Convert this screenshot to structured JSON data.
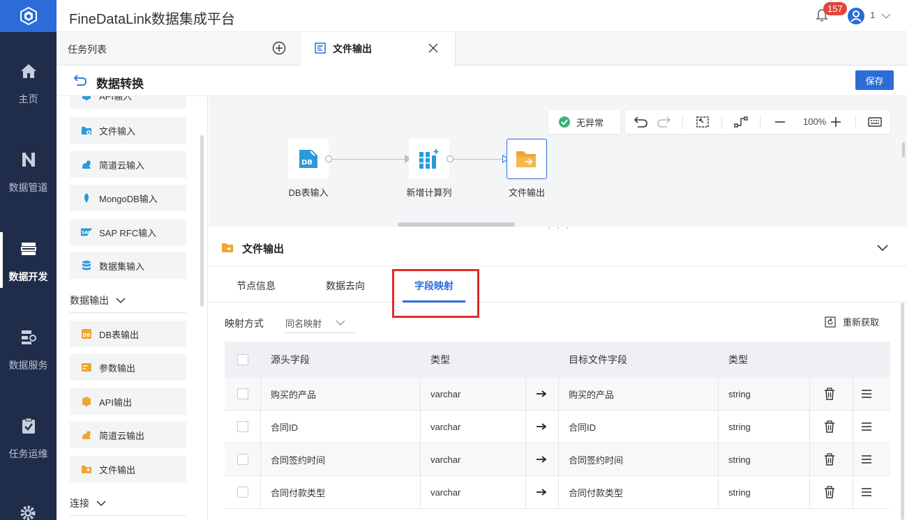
{
  "app": {
    "title": "FineDataLink数据集成平台",
    "notification_count": "157",
    "user_name": "1"
  },
  "nav": {
    "items": [
      {
        "label": "主页",
        "icon": "home-icon"
      },
      {
        "label": "数据管道",
        "icon": "pipeline-icon"
      },
      {
        "label": "数据开发",
        "icon": "data-dev-icon",
        "active": true
      },
      {
        "label": "数据服务",
        "icon": "data-service-icon"
      },
      {
        "label": "任务运维",
        "icon": "task-ops-icon"
      }
    ]
  },
  "tabs": {
    "list_label": "任务列表",
    "active_label": "文件输出"
  },
  "subheader": {
    "title": "数据转换",
    "save_label": "保存"
  },
  "components": {
    "items_top": [
      "API输入",
      "文件输入",
      "简道云输入",
      "MongoDB输入",
      "SAP RFC输入",
      "数据集输入"
    ],
    "output_section": "数据输出",
    "items_output": [
      "DB表输出",
      "参数输出",
      "API输出",
      "简道云输出",
      "文件输出"
    ],
    "connect_section": "连接"
  },
  "canvas": {
    "status": "无异常",
    "zoom": "100%",
    "nodes": [
      {
        "label": "DB表输入",
        "icon": "db-input-icon"
      },
      {
        "label": "新增计算列",
        "icon": "calc-column-icon"
      },
      {
        "label": "文件输出",
        "icon": "file-output-icon"
      }
    ]
  },
  "config": {
    "title": "文件输出",
    "tabs": [
      "节点信息",
      "数据去向",
      "字段映射"
    ],
    "active_tab": "字段映射",
    "mapping_label": "映射方式",
    "mapping_value": "同名映射",
    "refetch_label": "重新获取",
    "table": {
      "headers": [
        "源头字段",
        "类型",
        "目标文件字段",
        "类型"
      ],
      "rows": [
        {
          "source": "购买的产品",
          "source_type": "varchar",
          "target": "购买的产品",
          "target_type": "string"
        },
        {
          "source": "合同ID",
          "source_type": "varchar",
          "target": "合同ID",
          "target_type": "string"
        },
        {
          "source": "合同签约时间",
          "source_type": "varchar",
          "target": "合同签约时间",
          "target_type": "string"
        },
        {
          "source": "合同付款类型",
          "source_type": "varchar",
          "target": "合同付款类型",
          "target_type": "string"
        }
      ]
    }
  },
  "colors": {
    "nav_bg": "#1f2d4a",
    "accent": "#2b6cd9",
    "badge": "#e2453c",
    "highlight": "#e02a2a",
    "node_orange": "#f0a530"
  }
}
